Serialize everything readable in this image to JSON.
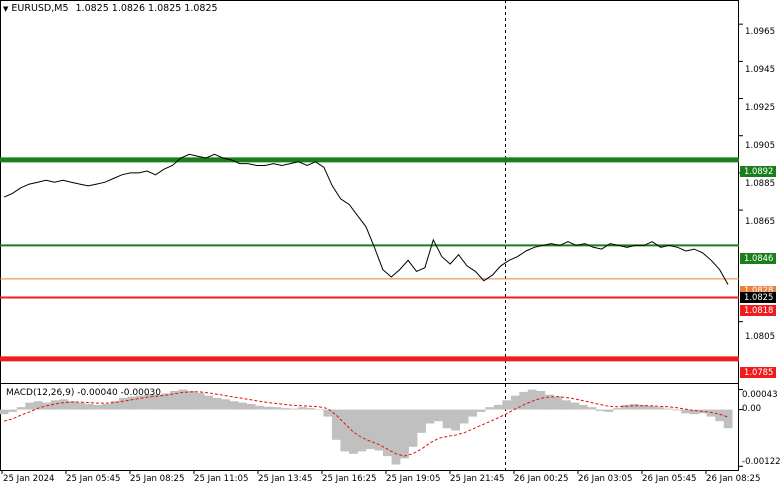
{
  "header": {
    "symbol_label": "EURUSD,M5",
    "quote": "1.0825 1.0826 1.0825 1.0825"
  },
  "macd": {
    "label": "MACD(12,26,9) -0.00040 -0.00030",
    "axis": [
      "0.00043",
      "0.00",
      "-0.00122"
    ]
  },
  "price_axis": [
    "1.0965",
    "1.0945",
    "1.0925",
    "1.0905",
    "1.0885",
    "1.0865",
    "1.0805"
  ],
  "levels": [
    {
      "label": "1.0892",
      "color": "#1a7f1a",
      "kind": "resistance-thick"
    },
    {
      "label": "1.0846",
      "color": "#1a7f1a",
      "kind": "target"
    },
    {
      "label": "1.0828",
      "color": "#e8803a",
      "kind": "current-open"
    },
    {
      "label": "1.0825",
      "color": "#000000",
      "kind": "bid"
    },
    {
      "label": "1.0818",
      "color": "#ee1c1c",
      "kind": "support"
    },
    {
      "label": "1.0785",
      "color": "#ee1c1c",
      "kind": "support-thick"
    }
  ],
  "time_axis": [
    "25 Jan 2024",
    "25 Jan 05:45",
    "25 Jan 08:25",
    "25 Jan 11:05",
    "25 Jan 13:45",
    "25 Jan 16:25",
    "25 Jan 19:05",
    "25 Jan 21:45",
    "26 Jan 00:25",
    "26 Jan 03:05",
    "26 Jan 05:45",
    "26 Jan 08:25"
  ],
  "chart_data": {
    "type": "line",
    "series": [
      {
        "values": [
          1.0872,
          1.0874,
          1.0877,
          1.0879,
          1.088,
          1.0881,
          1.088,
          1.0881,
          1.088,
          1.0879,
          1.0878,
          1.0879,
          1.088,
          1.0882,
          1.0884,
          1.0885,
          1.0885,
          1.0886,
          1.0884,
          1.0887,
          1.0889,
          1.0893,
          1.0895,
          1.0894,
          1.0893,
          1.0895,
          1.0893,
          1.0892,
          1.089,
          1.089,
          1.0889,
          1.0889,
          1.089,
          1.0889,
          1.089,
          1.0891,
          1.0889,
          1.0891,
          1.0888,
          1.0878,
          1.0871,
          1.0868,
          1.0862,
          1.0856,
          1.0845,
          1.0833,
          1.0829,
          1.0833,
          1.0838,
          1.0832,
          1.0834,
          1.0849,
          1.084,
          1.0836,
          1.0841,
          1.0835,
          1.0832,
          1.0827,
          1.083,
          1.0835,
          1.0838,
          1.084,
          1.0843,
          1.0845,
          1.0846,
          1.0847,
          1.0846,
          1.0848,
          1.0846,
          1.0847,
          1.0845,
          1.0844,
          1.0847,
          1.0846,
          1.0845,
          1.0846,
          1.0846,
          1.0848,
          1.0845,
          1.0846,
          1.0845,
          1.0843,
          1.0844,
          1.0842,
          1.0838,
          1.0833,
          1.0825
        ]
      }
    ],
    "macd_histogram": [
      -0.0001,
      -5e-05,
      5e-05,
      0.00015,
      0.00018,
      0.00015,
      0.0002,
      0.00022,
      0.00018,
      0.00015,
      0.00012,
      0.0001,
      0.00012,
      0.00018,
      0.00025,
      0.00028,
      0.0003,
      0.00033,
      0.00032,
      0.00035,
      0.0004,
      0.00043,
      0.0004,
      0.00036,
      0.0003,
      0.00025,
      0.00022,
      0.00018,
      0.00015,
      0.00012,
      8e-05,
      6e-05,
      5e-05,
      3e-05,
      2e-05,
      5e-05,
      3e-05,
      1e-05,
      -0.00015,
      -0.00065,
      -0.0009,
      -0.00095,
      -0.0009,
      -0.00085,
      -0.00088,
      -0.001,
      -0.00118,
      -0.00105,
      -0.0008,
      -0.0005,
      -0.0003,
      -0.00025,
      -0.0004,
      -0.00045,
      -0.0003,
      -0.00015,
      -5e-05,
      5e-05,
      0.0001,
      0.0002,
      0.0003,
      0.00038,
      0.00043,
      0.0004,
      0.00032,
      0.00028,
      0.0002,
      0.00015,
      0.0001,
      5e-05,
      -3e-05,
      -5e-05,
      3e-05,
      0.0001,
      0.00012,
      0.0001,
      8e-05,
      5e-05,
      2e-05,
      -2e-05,
      -8e-05,
      -0.0001,
      -8e-05,
      -0.00015,
      -0.00025,
      -0.0004
    ],
    "macd_signal": [
      -0.00025,
      -0.0002,
      -0.00012,
      -5e-05,
      3e-05,
      8e-05,
      0.00012,
      0.00015,
      0.00016,
      0.00016,
      0.00015,
      0.00014,
      0.00014,
      0.00015,
      0.00018,
      0.00021,
      0.00024,
      0.00027,
      0.00029,
      0.00031,
      0.00034,
      0.00037,
      0.00038,
      0.00038,
      0.00036,
      0.00033,
      0.0003,
      0.00027,
      0.00024,
      0.00021,
      0.00018,
      0.00015,
      0.00013,
      0.00011,
      9e-05,
      8e-05,
      7e-05,
      6e-05,
      2e-05,
      -0.00012,
      -0.0003,
      -0.00048,
      -0.0006,
      -0.00068,
      -0.00075,
      -0.00085,
      -0.00095,
      -0.001,
      -0.00095,
      -0.00085,
      -0.00072,
      -0.00062,
      -0.00058,
      -0.00055,
      -0.0005,
      -0.00042,
      -0.00034,
      -0.00026,
      -0.00018,
      -9e-05,
      1e-05,
      0.0001,
      0.00018,
      0.00024,
      0.00027,
      0.00028,
      0.00026,
      0.00023,
      0.00019,
      0.00015,
      0.00011,
      7e-05,
      6e-05,
      7e-05,
      8e-05,
      8e-05,
      8e-05,
      7e-05,
      6e-05,
      4e-05,
      1e-05,
      -2e-05,
      -4e-05,
      -6e-05,
      -0.0001,
      -0.00016
    ],
    "ylim": [
      1.0772,
      1.0978
    ],
    "macd_ylim": [
      -0.0013,
      0.00055
    ],
    "grid": false
  }
}
